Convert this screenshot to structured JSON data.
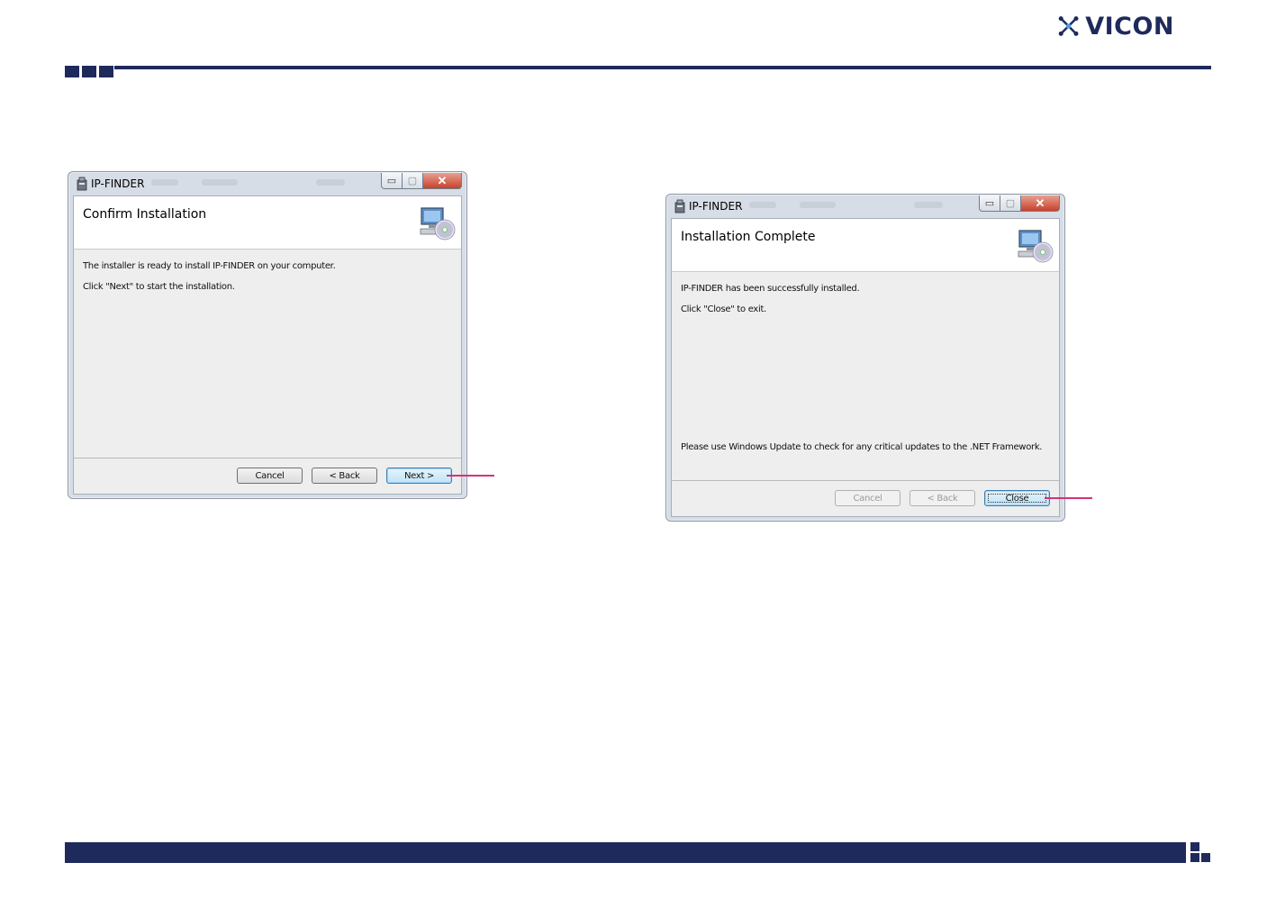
{
  "brand": {
    "name": "VICON",
    "color": "#1f2a5c",
    "icon": "vicon-star-icon"
  },
  "colors": {
    "navy": "#1f2a5c",
    "callout": "#d4327a"
  },
  "dialogs": [
    {
      "title": "IP-FINDER",
      "heading": "Confirm Installation",
      "lines": [
        "The installer is ready to install IP-FINDER on your computer.",
        "Click \"Next\" to start the installation."
      ],
      "note": "",
      "buttons": [
        {
          "label": "Cancel",
          "state": "enabled"
        },
        {
          "label": "< Back",
          "state": "enabled"
        },
        {
          "label": "Next >",
          "state": "default"
        }
      ],
      "controls": {
        "minimize": "▭",
        "maximize": "▢",
        "close": "✕"
      }
    },
    {
      "title": "IP-FINDER",
      "heading": "Installation Complete",
      "lines": [
        "IP-FINDER has been successfully installed.",
        "Click \"Close\" to exit."
      ],
      "note": "Please use Windows Update to check for any critical updates to the .NET Framework.",
      "buttons": [
        {
          "label": "Cancel",
          "state": "disabled"
        },
        {
          "label": "< Back",
          "state": "disabled"
        },
        {
          "label": "Close",
          "state": "default"
        }
      ],
      "controls": {
        "minimize": "▭",
        "maximize": "▢",
        "close": "✕"
      }
    }
  ]
}
